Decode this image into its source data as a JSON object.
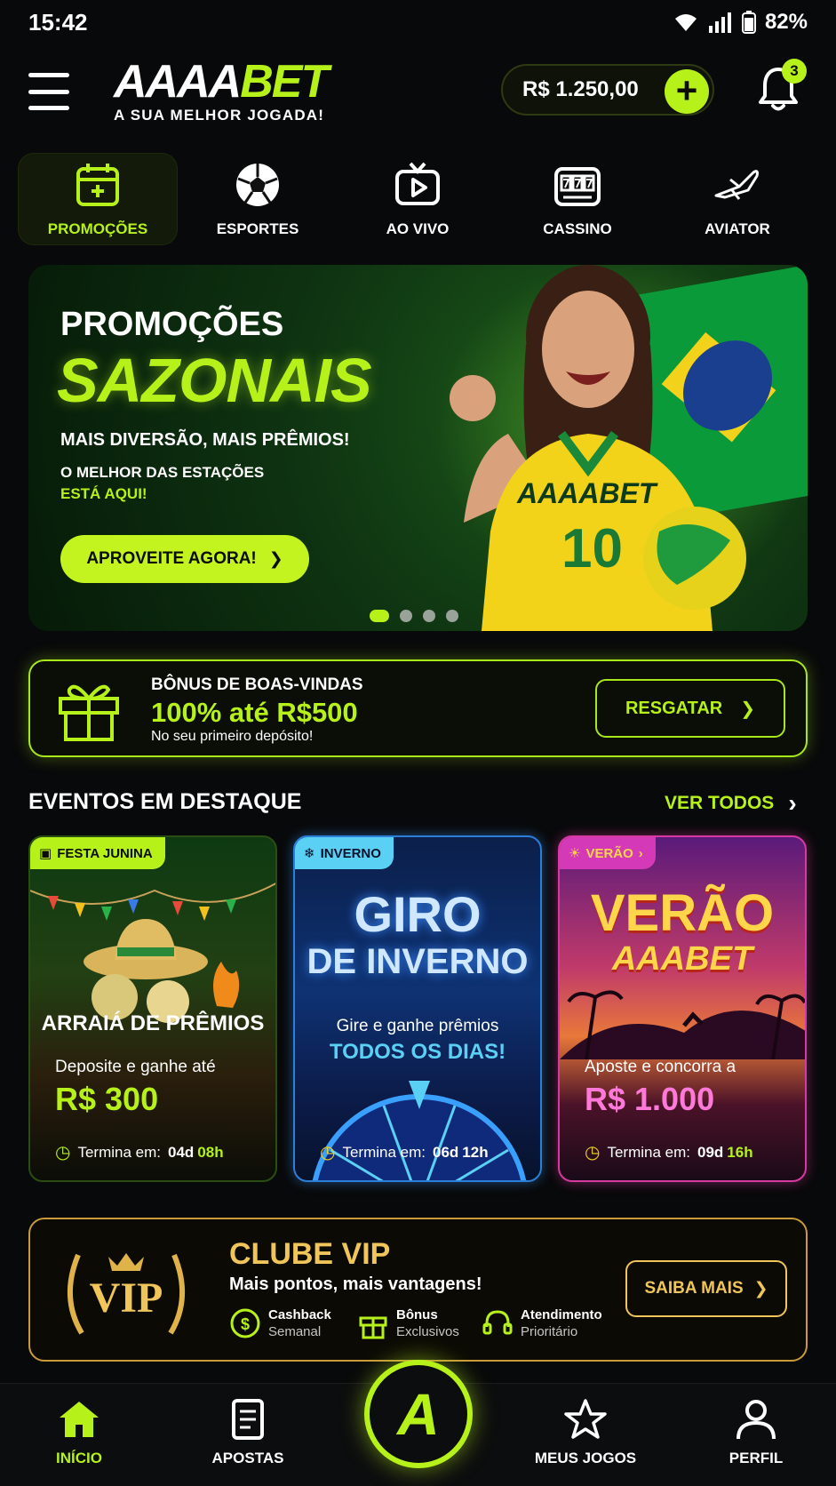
{
  "status_bar": {
    "time": "15:42",
    "battery": "82%"
  },
  "header": {
    "logo_white": "AAAA",
    "logo_green": "BET",
    "tagline": "A SUA MELHOR JOGADA!",
    "balance": "R$ 1.250,00",
    "notifications_count": "3"
  },
  "categories": [
    {
      "label": "PROMOÇÕES",
      "icon": "calendar-icon",
      "active": true
    },
    {
      "label": "ESPORTES",
      "icon": "soccer-ball-icon"
    },
    {
      "label": "AO VIVO",
      "icon": "tv-play-icon"
    },
    {
      "label": "CASSINO",
      "icon": "slot-machine-icon"
    },
    {
      "label": "AVIATOR",
      "icon": "airplane-icon"
    }
  ],
  "hero": {
    "title_top": "PROMOÇÕES",
    "title_main": "SAZONAIS",
    "subtitle": "MAIS DIVERSÃO, MAIS PRÊMIOS!",
    "line1": "O MELHOR DAS ESTAÇÕES",
    "line2": "ESTÁ AQUI!",
    "cta": "APROVEITE AGORA!",
    "jersey_text": "AAAABET",
    "jersey_number": "10",
    "slides": 4,
    "active_slide": 1
  },
  "bonus": {
    "label": "BÔNUS DE BOAS-VINDAS",
    "amount": "100% até R$500",
    "note": "No seu primeiro depósito!",
    "button": "RESGATAR"
  },
  "featured": {
    "title": "EVENTOS EM DESTAQUE",
    "see_all": "VER TODOS",
    "events": [
      {
        "tag": "FESTA JUNINA",
        "title": "ARRAIÁ DE PRÊMIOS",
        "desc": "Deposite e ganhe até",
        "amount": "R$ 300",
        "timer_label": "Termina em:",
        "days": "04d",
        "hours": "08h"
      },
      {
        "tag": "INVERNO",
        "title_line1": "GIRO",
        "title_line2": "DE INVERNO",
        "desc": "Gire e ganhe prêmios",
        "highlight": "TODOS OS DIAS!",
        "timer_label": "Termina em:",
        "days": "06d",
        "hours": "12h"
      },
      {
        "tag": "VERÃO",
        "title_line1": "VERÃO",
        "title_line2": "AAABET",
        "desc": "Aposte e concorra a",
        "amount": "R$ 1.000",
        "timer_label": "Termina em:",
        "days": "09d",
        "hours": "16h"
      }
    ]
  },
  "vip": {
    "badge": "VIP",
    "title": "CLUBE VIP",
    "subtitle": "Mais pontos, mais vantagens!",
    "features": [
      {
        "a": "Cashback",
        "b": "Semanal",
        "icon": "cashback-icon"
      },
      {
        "a": "Bônus",
        "b": "Exclusivos",
        "icon": "gift-icon"
      },
      {
        "a": "Atendimento",
        "b": "Prioritário",
        "icon": "headset-icon"
      }
    ],
    "button": "SAIBA MAIS"
  },
  "nav": {
    "items": [
      {
        "label": "INÍCIO",
        "icon": "home-icon",
        "active": true
      },
      {
        "label": "APOSTAS",
        "icon": "betslip-icon"
      },
      {
        "label": "MEUS JOGOS",
        "icon": "star-icon"
      },
      {
        "label": "PERFIL",
        "icon": "user-icon"
      }
    ],
    "center_letter": "A"
  },
  "colors": {
    "accent": "#b6f21a",
    "gold": "#f0c65a",
    "background": "#08090a",
    "winter": "#5ad0f5",
    "summer": "#d43ab8"
  }
}
